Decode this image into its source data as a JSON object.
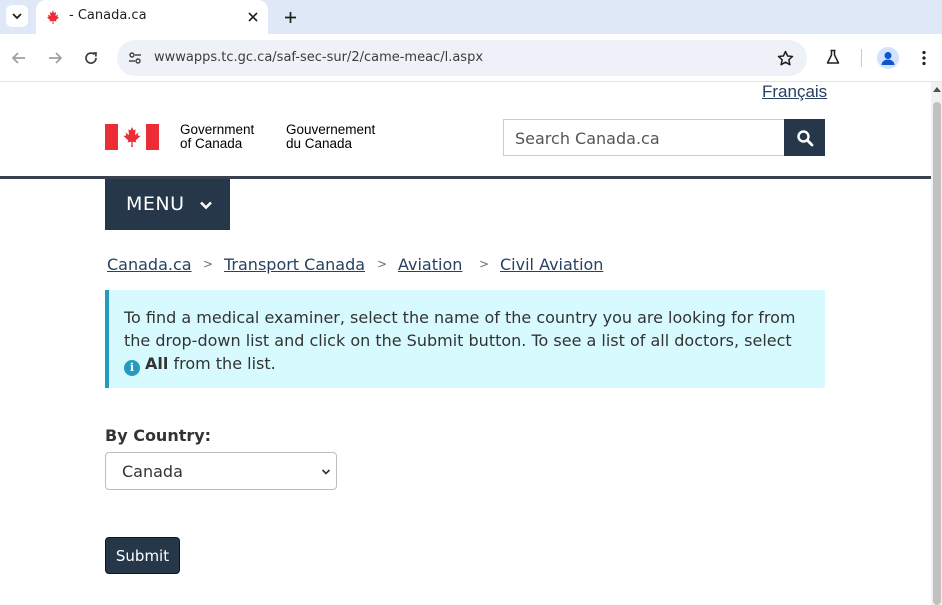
{
  "browser": {
    "tab_title": "- Canada.ca",
    "url": "wwwapps.tc.gc.ca/saf-sec-sur/2/came-meac/l.aspx",
    "icons": [
      "chevron-down-icon",
      "maple-leaf-favicon",
      "close-icon",
      "plus-icon",
      "back-arrow-icon",
      "forward-arrow-icon",
      "reload-icon",
      "site-info-icon",
      "star-icon",
      "labs-flask-icon",
      "profile-icon",
      "kebab-menu-icon"
    ]
  },
  "header": {
    "language_link": "Français",
    "signature_en_line1": "Government",
    "signature_en_line2": "of Canada",
    "signature_fr_line1": "Gouvernement",
    "signature_fr_line2": "du Canada",
    "search_placeholder": "Search Canada.ca",
    "menu_label": "MENU"
  },
  "breadcrumb": {
    "items": [
      "Canada.ca",
      "Transport Canada",
      "Aviation",
      "Civil Aviation"
    ],
    "separator": ">"
  },
  "alert": {
    "text_before": "To find a medical examiner, select the name of the country you are looking for from the drop-down list and click on the Submit button. To see a list of all doctors, select",
    "strong": "All",
    "text_after": "from the list."
  },
  "form": {
    "country_label": "By Country:",
    "country_selected": "Canada",
    "submit_label": "Submit"
  },
  "colors": {
    "gc_navy": "#26374a",
    "link": "#284162",
    "alert_bg": "#d7faff",
    "alert_border": "#269abc",
    "flag_red": "#eb2d37"
  }
}
